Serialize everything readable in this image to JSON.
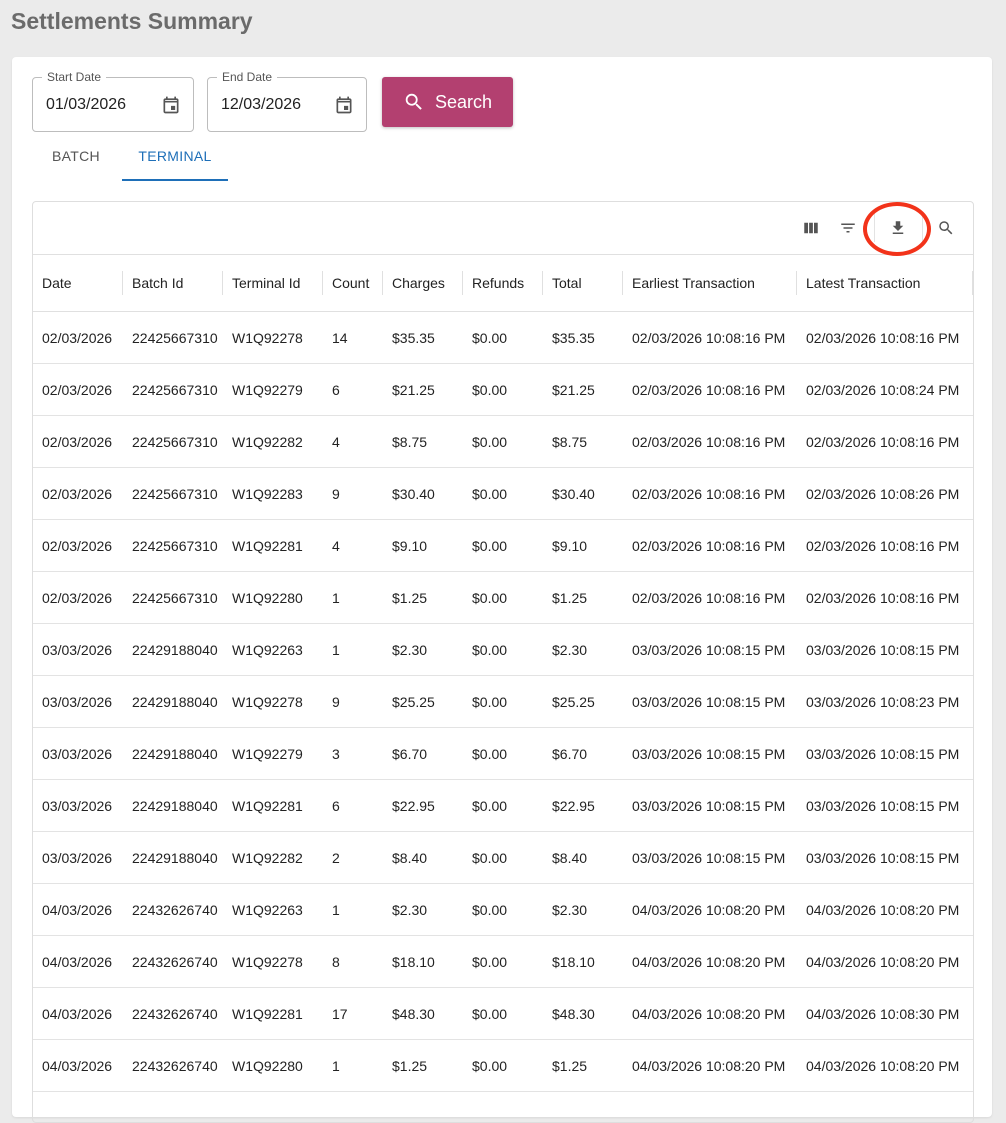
{
  "page": {
    "title": "Settlements Summary"
  },
  "filters": {
    "start_date": {
      "label": "Start Date",
      "value": "01/03/2026",
      "icon": "calendar-icon"
    },
    "end_date": {
      "label": "End Date",
      "value": "12/03/2026",
      "icon": "calendar-icon"
    },
    "search_button": {
      "label": "Search",
      "icon": "search-icon",
      "color": "#b34070"
    }
  },
  "tabs": [
    {
      "label": "BATCH",
      "active": false
    },
    {
      "label": "TERMINAL",
      "active": true
    }
  ],
  "toolbar": {
    "icons": [
      "columns-icon",
      "filter-icon",
      "download-icon",
      "search-icon"
    ],
    "highlighted": "download-icon",
    "highlight_color": "#f2331a"
  },
  "table": {
    "columns": [
      "Date",
      "Batch Id",
      "Terminal Id",
      "Count",
      "Charges",
      "Refunds",
      "Total",
      "Earliest Transaction",
      "Latest Transaction"
    ],
    "rows": [
      [
        "02/03/2026",
        "22425667310",
        "W1Q92278",
        "14",
        "$35.35",
        "$0.00",
        "$35.35",
        "02/03/2026 10:08:16 PM",
        "02/03/2026 10:08:16 PM"
      ],
      [
        "02/03/2026",
        "22425667310",
        "W1Q92279",
        "6",
        "$21.25",
        "$0.00",
        "$21.25",
        "02/03/2026 10:08:16 PM",
        "02/03/2026 10:08:24 PM"
      ],
      [
        "02/03/2026",
        "22425667310",
        "W1Q92282",
        "4",
        "$8.75",
        "$0.00",
        "$8.75",
        "02/03/2026 10:08:16 PM",
        "02/03/2026 10:08:16 PM"
      ],
      [
        "02/03/2026",
        "22425667310",
        "W1Q92283",
        "9",
        "$30.40",
        "$0.00",
        "$30.40",
        "02/03/2026 10:08:16 PM",
        "02/03/2026 10:08:26 PM"
      ],
      [
        "02/03/2026",
        "22425667310",
        "W1Q92281",
        "4",
        "$9.10",
        "$0.00",
        "$9.10",
        "02/03/2026 10:08:16 PM",
        "02/03/2026 10:08:16 PM"
      ],
      [
        "02/03/2026",
        "22425667310",
        "W1Q92280",
        "1",
        "$1.25",
        "$0.00",
        "$1.25",
        "02/03/2026 10:08:16 PM",
        "02/03/2026 10:08:16 PM"
      ],
      [
        "03/03/2026",
        "22429188040",
        "W1Q92263",
        "1",
        "$2.30",
        "$0.00",
        "$2.30",
        "03/03/2026 10:08:15 PM",
        "03/03/2026 10:08:15 PM"
      ],
      [
        "03/03/2026",
        "22429188040",
        "W1Q92278",
        "9",
        "$25.25",
        "$0.00",
        "$25.25",
        "03/03/2026 10:08:15 PM",
        "03/03/2026 10:08:23 PM"
      ],
      [
        "03/03/2026",
        "22429188040",
        "W1Q92279",
        "3",
        "$6.70",
        "$0.00",
        "$6.70",
        "03/03/2026 10:08:15 PM",
        "03/03/2026 10:08:15 PM"
      ],
      [
        "03/03/2026",
        "22429188040",
        "W1Q92281",
        "6",
        "$22.95",
        "$0.00",
        "$22.95",
        "03/03/2026 10:08:15 PM",
        "03/03/2026 10:08:15 PM"
      ],
      [
        "03/03/2026",
        "22429188040",
        "W1Q92282",
        "2",
        "$8.40",
        "$0.00",
        "$8.40",
        "03/03/2026 10:08:15 PM",
        "03/03/2026 10:08:15 PM"
      ],
      [
        "04/03/2026",
        "22432626740",
        "W1Q92263",
        "1",
        "$2.30",
        "$0.00",
        "$2.30",
        "04/03/2026 10:08:20 PM",
        "04/03/2026 10:08:20 PM"
      ],
      [
        "04/03/2026",
        "22432626740",
        "W1Q92278",
        "8",
        "$18.10",
        "$0.00",
        "$18.10",
        "04/03/2026 10:08:20 PM",
        "04/03/2026 10:08:20 PM"
      ],
      [
        "04/03/2026",
        "22432626740",
        "W1Q92281",
        "17",
        "$48.30",
        "$0.00",
        "$48.30",
        "04/03/2026 10:08:20 PM",
        "04/03/2026 10:08:30 PM"
      ],
      [
        "04/03/2026",
        "22432626740",
        "W1Q92280",
        "1",
        "$1.25",
        "$0.00",
        "$1.25",
        "04/03/2026 10:08:20 PM",
        "04/03/2026 10:08:20 PM"
      ]
    ]
  }
}
